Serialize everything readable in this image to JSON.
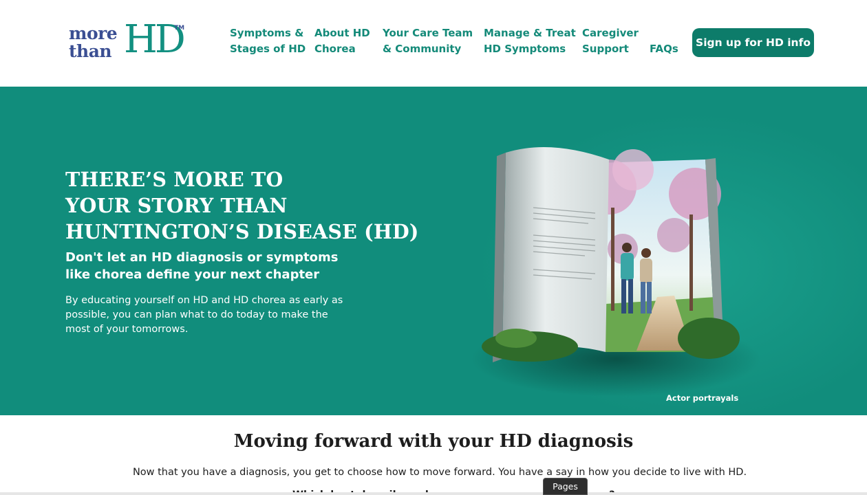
{
  "logo": {
    "line1": "more",
    "line2": "than",
    "mark": "HD",
    "tm": "TM"
  },
  "nav": {
    "items": [
      {
        "line1": "Symptoms &",
        "line2": "Stages of HD"
      },
      {
        "line1": "About HD",
        "line2": "Chorea"
      },
      {
        "line1": "Your Care Team",
        "line2": "& Community"
      },
      {
        "line1": "Manage & Treat",
        "line2": "HD Symptoms"
      },
      {
        "line1": "Caregiver",
        "line2": "Support"
      },
      {
        "line1": "FAQs",
        "line2": ""
      }
    ],
    "signup_label": "Sign up for HD info"
  },
  "hero": {
    "title_part1": "THERE’S ",
    "title_bold": "MORE",
    "title_part2": " TO",
    "title_line2": "YOUR STORY THAN",
    "title_line3": "HUNTINGTON’S DISEASE (HD)",
    "subtitle": "Don't let an HD diagnosis or symptoms like chorea define your next chapter",
    "body": "By educating yourself on HD and HD chorea as early as possible, you can plan what to do today to make the most of your tomorrows.",
    "actor_note": "Actor portrayals"
  },
  "section": {
    "title": "Moving forward with your HD diagnosis",
    "body": "Now that you have a diagnosis, you get to choose how to move forward. You have a say in how you decide to live with HD.",
    "cut_text": "Which best describes where you are on your HD journey?"
  },
  "pages_tab": "Pages",
  "colors": {
    "brand_teal": "#118d7c",
    "nav_text": "#148a79",
    "button": "#0d7c6a",
    "logo_navy": "#3b4f93"
  }
}
